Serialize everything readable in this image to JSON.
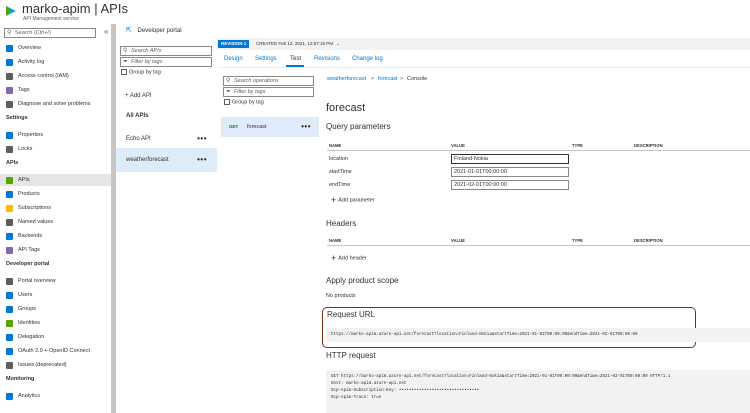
{
  "header": {
    "title": "marko-apim | APIs",
    "subtitle": "API Management service"
  },
  "nav": {
    "search_placeholder": "Search (Ctrl+/)",
    "collapse_glyph": "«",
    "top_items": [
      {
        "label": "Overview",
        "icon": "overview-icon",
        "color": "#0078d4"
      },
      {
        "label": "Activity log",
        "icon": "activity-log-icon",
        "color": "#0078d4"
      },
      {
        "label": "Access control (IAM)",
        "icon": "iam-icon",
        "color": "#605e5c"
      },
      {
        "label": "Tags",
        "icon": "tag-icon",
        "color": "#8764b8"
      },
      {
        "label": "Diagnose and solve problems",
        "icon": "wrench-icon",
        "color": "#605e5c"
      }
    ],
    "settings_header": "Settings",
    "settings_items": [
      {
        "label": "Properties",
        "icon": "properties-icon",
        "color": "#0078d4"
      },
      {
        "label": "Locks",
        "icon": "lock-icon",
        "color": "#605e5c"
      }
    ],
    "apis_header": "APIs",
    "apis_items": [
      {
        "label": "APIs",
        "icon": "apis-icon",
        "color": "#57a300",
        "active": true
      },
      {
        "label": "Products",
        "icon": "products-icon",
        "color": "#0078d4"
      },
      {
        "label": "Subscriptions",
        "icon": "key-icon",
        "color": "#ffb900"
      },
      {
        "label": "Named values",
        "icon": "named-values-icon",
        "color": "#605e5c"
      },
      {
        "label": "Backends",
        "icon": "backends-icon",
        "color": "#0078d4"
      },
      {
        "label": "API Tags",
        "icon": "tag-icon",
        "color": "#8764b8"
      }
    ],
    "devportal_header": "Developer portal",
    "devportal_items": [
      {
        "label": "Portal overview",
        "icon": "portal-icon",
        "color": "#605e5c"
      },
      {
        "label": "Users",
        "icon": "user-icon",
        "color": "#0078d4"
      },
      {
        "label": "Groups",
        "icon": "group-icon",
        "color": "#0078d4"
      },
      {
        "label": "Identities",
        "icon": "identity-icon",
        "color": "#57a300"
      },
      {
        "label": "Delegation",
        "icon": "delegation-icon",
        "color": "#0078d4"
      },
      {
        "label": "OAuth 2.0 + OpenID Connect",
        "icon": "shield-icon",
        "color": "#0078d4"
      },
      {
        "label": "Issues (deprecated)",
        "icon": "issues-icon",
        "color": "#605e5c"
      }
    ],
    "monitoring_header": "Monitoring",
    "monitoring_items": [
      {
        "label": "Analytics",
        "icon": "analytics-icon",
        "color": "#0078d4"
      }
    ]
  },
  "toolbar": {
    "developer_portal": "Developer portal"
  },
  "apis_panel": {
    "search_placeholder": "Search APIs",
    "filter_placeholder": "Filter by tags",
    "group_by_tag": "Group by tag",
    "add_api": "+ Add API",
    "all_apis": "All APIs",
    "apis": [
      {
        "name": "Echo API",
        "selected": false
      },
      {
        "name": "weatherforecast",
        "selected": true
      }
    ],
    "more_glyph": "•••"
  },
  "operations_panel": {
    "search_placeholder": "Search operations",
    "filter_placeholder": "Filter by tags",
    "group_by_tag": "Group by tag",
    "operation": {
      "method": "GET",
      "name": "forecast"
    },
    "more_glyph": "•••"
  },
  "revision": {
    "badge": "REVISION 1",
    "created": "CREATED Feb 12, 2021, 12:57:19 PM"
  },
  "tabs": [
    "Design",
    "Settings",
    "Test",
    "Revisions",
    "Change log"
  ],
  "active_tab": "Test",
  "breadcrumb": {
    "api": "weatherforecast",
    "sep": ">",
    "operation": "forecast",
    "current": "Console"
  },
  "console": {
    "title": "forecast",
    "query_params_title": "Query parameters",
    "columns": {
      "name": "NAME",
      "value": "VALUE",
      "type": "TYPE",
      "description": "DESCRIPTION"
    },
    "params": [
      {
        "name": "location",
        "value": "Finland-Nokia"
      },
      {
        "name": "startTime",
        "value": "2021-01-01T00:00:00"
      },
      {
        "name": "endTime",
        "value": "2021-02-01T00:00:00"
      }
    ],
    "add_parameter": "Add parameter",
    "headers_title": "Headers",
    "add_header": "Add header",
    "product_scope_title": "Apply product scope",
    "product_scope_value": "No products",
    "request_url_title": "Request URL",
    "request_url": "https://marko-apim.azure-api.net/forecast?location=Finland-Nokia&startTime=2021-01-01T00:00:00&endTime=2021-02-01T00:00:00",
    "http_request_title": "HTTP request",
    "http_request_lines": [
      "GET https://marko-apim.azure-api.net/forecast?location=Finland-Nokia&startTime=2021-01-01T00:00:00&endTime=2021-02-01T00:00:00 HTTP/1.1",
      "Host: marko-apim.azure-api.net",
      "Ocp-Apim-Subscription-Key: ••••••••••••••••••••••••••••••••",
      "Ocp-Apim-Trace: true"
    ]
  },
  "colors": {
    "accent": "#0078d4",
    "selected_bg": "#deecf9",
    "highlight_border": "#7a3414"
  }
}
